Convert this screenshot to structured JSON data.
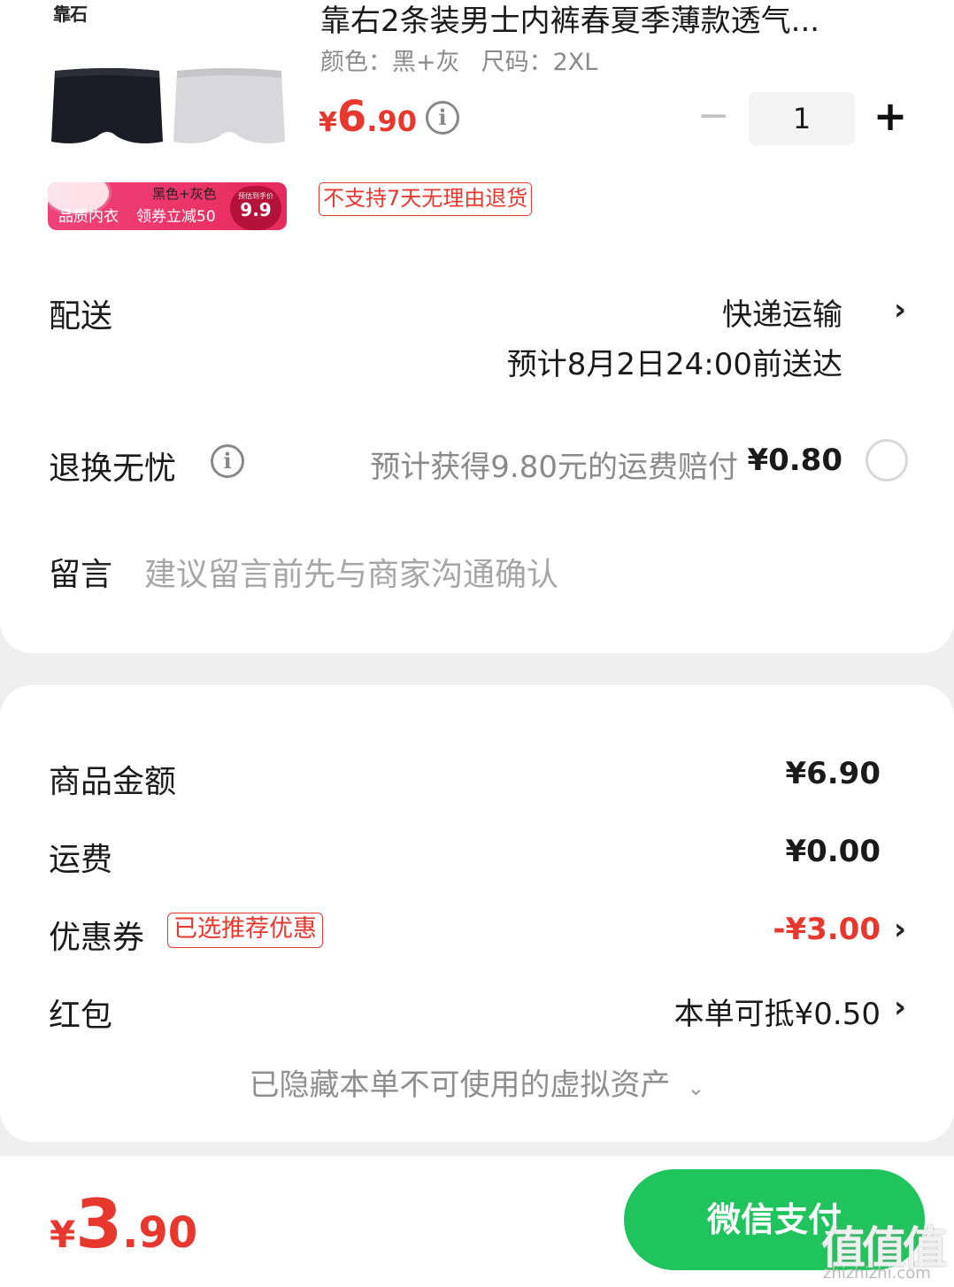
{
  "product": {
    "brand": "靠石",
    "promo": {
      "left": "品质内衣",
      "mid": "领券立减50",
      "colors": "黑色+灰色",
      "badge_small": "预估到手价",
      "badge_price": "9.9"
    },
    "title": "靠右2条装男士内裤春夏季薄款透气...",
    "spec_color": "颜色：黑+灰",
    "spec_size": "尺码：2XL",
    "price_currency": "¥",
    "price_int": "6",
    "price_dec": ".90",
    "quantity": "1",
    "return_tag": "不支持7天无理由退货"
  },
  "delivery": {
    "label": "配送",
    "method": "快递运输",
    "eta": "预计8月2日24:00前送达"
  },
  "return_service": {
    "label": "退换无忧",
    "desc": "预计获得9.80元的运费赔付",
    "price": "¥0.80"
  },
  "message": {
    "label": "留言",
    "placeholder": "建议留言前先与商家沟通确认"
  },
  "summary": {
    "goods_label": "商品金额",
    "goods_value": "¥6.90",
    "shipping_label": "运费",
    "shipping_value": "¥0.00",
    "coupon_label": "优惠券",
    "coupon_badge": "已选推荐优惠",
    "coupon_value": "-¥3.00",
    "redpacket_label": "红包",
    "redpacket_value": "本单可抵¥0.50",
    "hidden_note": "已隐藏本单不可使用的虚拟资产"
  },
  "footer": {
    "total_currency": "¥",
    "total_int": "3",
    "total_dec": ".90",
    "pay_label": "微信支付",
    "watermark": "值值值",
    "watermark_url": "zhizhizhi.com"
  },
  "colors": {
    "accent_red": "#e8382e",
    "pay_green": "#1fc55c"
  }
}
